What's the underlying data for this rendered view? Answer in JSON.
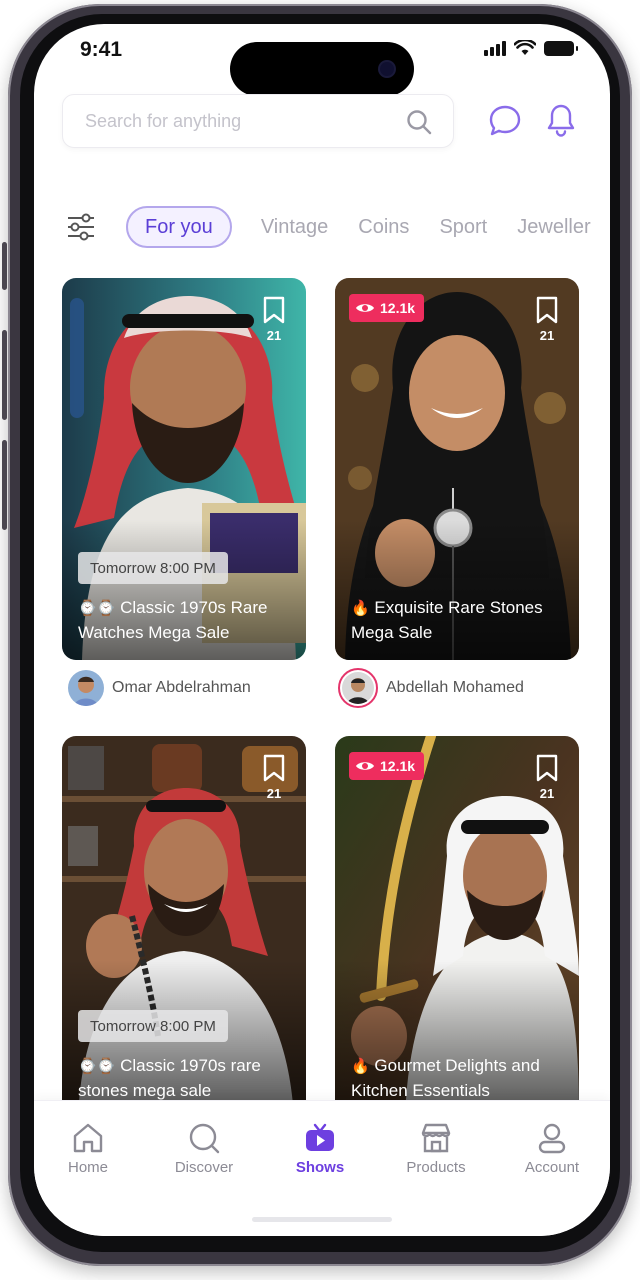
{
  "status_bar": {
    "time": "9:41"
  },
  "search": {
    "placeholder": "Search for anything"
  },
  "categories": [
    {
      "label": "For you",
      "active": true
    },
    {
      "label": "Vintage",
      "active": false
    },
    {
      "label": "Coins",
      "active": false
    },
    {
      "label": "Sport",
      "active": false
    },
    {
      "label": "Jeweller",
      "active": false
    }
  ],
  "cards": [
    {
      "bookmarks": "21",
      "views": "",
      "schedule": "Tomorrow 8:00 PM",
      "emoji": "⌚⌚",
      "title": "Classic 1970s Rare Watches Mega Sale",
      "author": "Omar Abdelrahman"
    },
    {
      "bookmarks": "21",
      "views": "12.1k",
      "schedule": "",
      "emoji": "🔥",
      "title": "Exquisite Rare Stones Mega Sale",
      "author": "Abdellah Mohamed"
    },
    {
      "bookmarks": "21",
      "views": "",
      "schedule": "Tomorrow 8:00 PM",
      "emoji": "⌚⌚",
      "title": "Classic 1970s rare stones mega sale",
      "author": ""
    },
    {
      "bookmarks": "21",
      "views": "12.1k",
      "schedule": "",
      "emoji": "🔥",
      "title": "Gourmet Delights and Kitchen Essentials",
      "author": ""
    }
  ],
  "tabbar": [
    {
      "label": "Home",
      "icon": "home-icon",
      "active": false
    },
    {
      "label": "Discover",
      "icon": "search-icon",
      "active": false
    },
    {
      "label": "Shows",
      "icon": "tv-play-icon",
      "active": true
    },
    {
      "label": "Products",
      "icon": "store-icon",
      "active": false
    },
    {
      "label": "Account",
      "icon": "user-icon",
      "active": false
    }
  ],
  "colors": {
    "accent": "#6d3fe0",
    "live_badge": "#ee2d5e",
    "chip_border": "#b4a7ec",
    "muted": "#a9a8b2"
  }
}
